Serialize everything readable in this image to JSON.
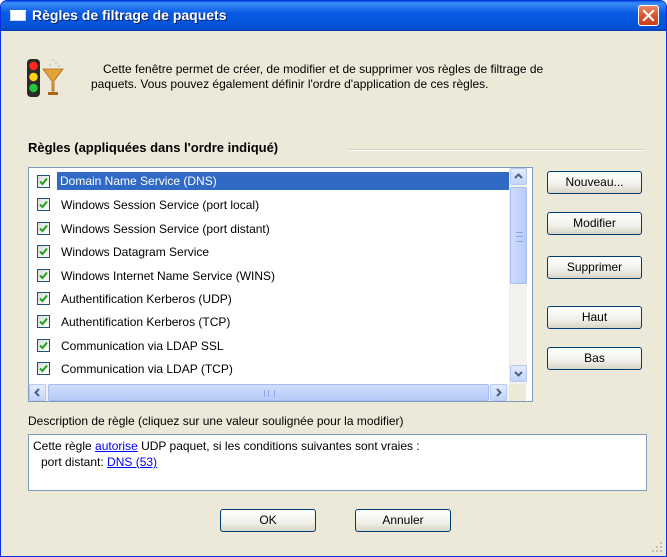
{
  "window": {
    "title": "Règles de filtrage de paquets",
    "icons": {
      "title": "window-icon",
      "close": "close-x-icon",
      "header": "traffic-light-filter-icon"
    }
  },
  "intro": {
    "line1": "Cette fenêtre permet de créer, de modifier et de supprimer vos règles de filtrage de",
    "line2": "paquets. Vous pouvez également définir l'ordre d'application de ces règles."
  },
  "rules": {
    "heading": "Règles (appliquées dans l'ordre indiqué)",
    "items": [
      {
        "label": "Domain Name Service (DNS)",
        "checked": true,
        "selected": true
      },
      {
        "label": "Windows Session Service (port local)",
        "checked": true
      },
      {
        "label": "Windows Session Service (port distant)",
        "checked": true
      },
      {
        "label": "Windows Datagram Service",
        "checked": true
      },
      {
        "label": "Windows Internet Name Service (WINS)",
        "checked": true
      },
      {
        "label": "Authentification Kerberos (UDP)",
        "checked": true
      },
      {
        "label": "Authentification Kerberos (TCP)",
        "checked": true
      },
      {
        "label": "Communication via LDAP SSL",
        "checked": true
      },
      {
        "label": "Communication via LDAP (TCP)",
        "checked": true
      }
    ]
  },
  "buttons": {
    "new": "Nouveau...",
    "modify": "Modifier",
    "delete": "Supprimer",
    "up": "Haut",
    "down": "Bas",
    "ok": "OK",
    "cancel": "Annuler"
  },
  "description": {
    "label": "Description de règle (cliquez sur une valeur soulignée pour la modifier)",
    "text1": "Cette règle",
    "action": "autorise",
    "text2": " UDP paquet, si les conditions suivantes sont vraies :",
    "port_label": "port distant:",
    "port_value": "DNS (53)"
  },
  "colors": {
    "title_bar": "#0a5ae6",
    "selection": "#316ac5",
    "face": "#ece9d8",
    "link": "#0000ee"
  }
}
